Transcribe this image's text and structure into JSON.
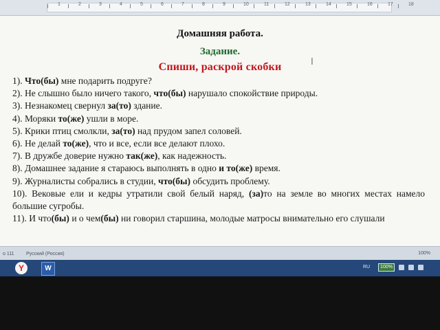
{
  "document": {
    "heading1": "Домашняя работа.",
    "heading2": "Задание.",
    "heading3": "Спиши, раскрой скобки",
    "lines": [
      [
        "1). ",
        {
          "b": "Что(бы)"
        },
        " мне подарить подруге?"
      ],
      [
        "2). Не слышно было ничего такого, ",
        {
          "b": "что(бы)"
        },
        " нарушало спокойствие природы."
      ],
      [
        "3). Незнакомец свернул ",
        {
          "b": "за(то)"
        },
        " здание."
      ],
      [
        "4). Моряки ",
        {
          "b": "то(же)"
        },
        " ушли в море."
      ],
      [
        "5). Крики птиц смолкли, ",
        {
          "b": "за(то)"
        },
        " над прудом запел соловей."
      ],
      [
        "6). Не делай ",
        {
          "b": "то(же)"
        },
        ", что и все, если все делают плохо."
      ],
      [
        "7). В дружбе доверие нужно ",
        {
          "b": "так(же)"
        },
        ", как надежность."
      ],
      [
        "8). Домашнее задание я стараюсь выполнять в одно ",
        {
          "b": "и то(же)"
        },
        " время."
      ],
      [
        "9). Журналисты собрались в студии, ",
        {
          "b": "что(бы)"
        },
        " обсудить проблему."
      ],
      [
        "10). Вековые ели и кедры утратили свой белый наряд, ",
        {
          "b": "(за)"
        },
        "то на земле во многих местах намело большие сугробы."
      ],
      [
        "11). И что",
        {
          "b": "(бы)"
        },
        " и о чем",
        {
          "b": "(бы)"
        },
        " ни говорил старшина, молодые матросы внимательно его слушали"
      ]
    ]
  },
  "ruler": {
    "numbers": [
      "1",
      "2",
      "3",
      "4",
      "5",
      "6",
      "7",
      "8",
      "9",
      "10",
      "11",
      "12",
      "13",
      "14",
      "15",
      "16",
      "17",
      "18"
    ]
  },
  "statusbar": {
    "page": "о 111",
    "language": "Русский (Россия)",
    "zoom": "100%"
  },
  "taskbar": {
    "yandex_label": "Y",
    "word_label": "W",
    "lang": "RU",
    "battery": "100%"
  },
  "colors": {
    "heading2": "#1c6a2a",
    "heading3": "#c0171c",
    "taskbar": "#25477a"
  },
  "icons": {
    "cursor": "text-cursor-icon"
  }
}
